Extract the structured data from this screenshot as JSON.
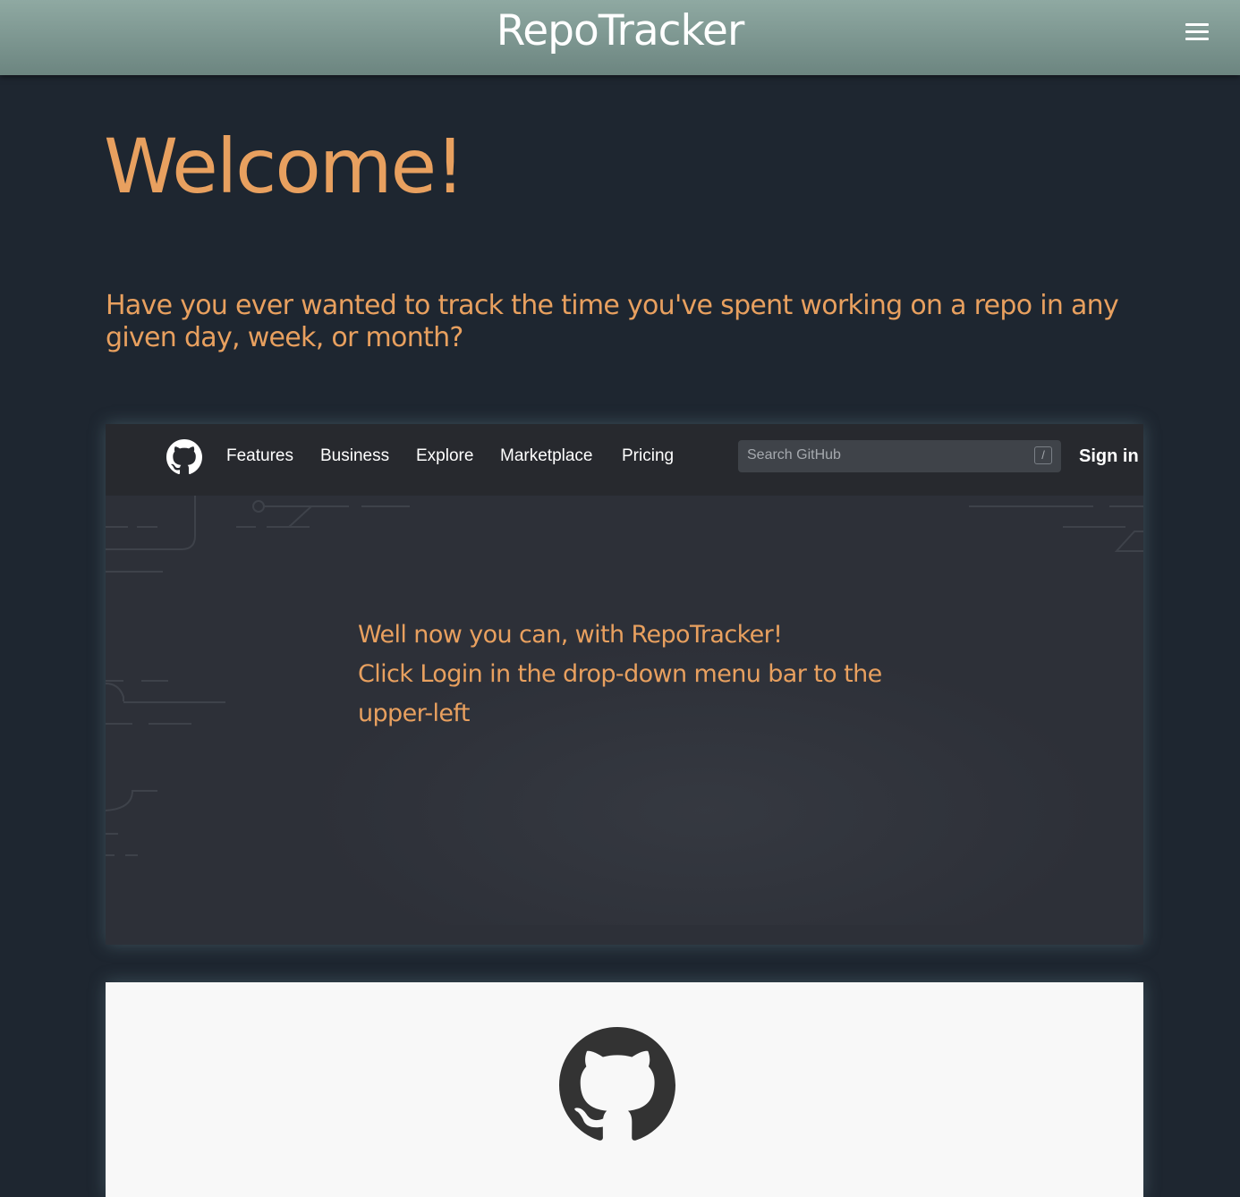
{
  "header": {
    "title": "RepoTracker",
    "menu_icon": "hamburger-menu-icon"
  },
  "main": {
    "heading": "Welcome!",
    "question": "Have you ever wanted to track the time you've spent working on a repo in any given day, week, or month?"
  },
  "github_preview": {
    "logo_icon": "github-octocat-icon",
    "nav_items": [
      {
        "label": "Features"
      },
      {
        "label": "Business"
      },
      {
        "label": "Explore"
      },
      {
        "label": "Marketplace"
      },
      {
        "label": "Pricing"
      }
    ],
    "search_placeholder": "Search GitHub",
    "search_shortcut": "/",
    "sign_in": "Sign in"
  },
  "hero": {
    "lines": [
      "Well now you can, with RepoTracker!",
      "Click Login in the drop-down menu bar to the",
      "upper-left"
    ]
  },
  "login_card": {
    "logo_icon": "github-octocat-icon"
  },
  "colors": {
    "accent": "#e8a05f",
    "background": "#1e2630",
    "header_gradient_top": "#8fa9a2",
    "header_gradient_bottom": "#6c8580"
  }
}
